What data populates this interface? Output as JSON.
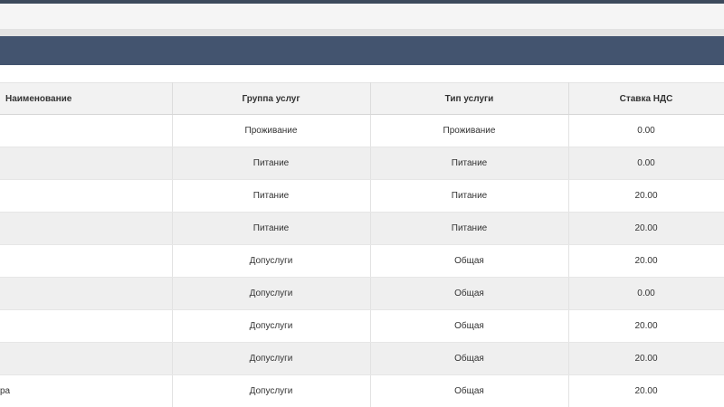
{
  "table": {
    "headers": [
      "Наименование",
      "Группа услуг",
      "Тип услуги",
      "Ставка НДС"
    ],
    "rows": [
      {
        "name": "",
        "group": "Проживание",
        "type": "Проживание",
        "vat": "0.00"
      },
      {
        "name": "",
        "group": "Питание",
        "type": "Питание",
        "vat": "0.00"
      },
      {
        "name": "",
        "group": "Питание",
        "type": "Питание",
        "vat": "20.00"
      },
      {
        "name": "",
        "group": "Питание",
        "type": "Питание",
        "vat": "20.00"
      },
      {
        "name": "",
        "group": "Допуслуги",
        "type": "Общая",
        "vat": "20.00"
      },
      {
        "name": "",
        "group": "Допуслуги",
        "type": "Общая",
        "vat": "0.00"
      },
      {
        "name": "",
        "group": "Допуслуги",
        "type": "Общая",
        "vat": "20.00"
      },
      {
        "name": "",
        "group": "Допуслуги",
        "type": "Общая",
        "vat": "20.00"
      },
      {
        "name": "ра",
        "group": "Допуслуги",
        "type": "Общая",
        "vat": "20.00"
      }
    ]
  },
  "colors": {
    "header_bar": "#43546f",
    "row_alt": "#efefef",
    "table_header_bg": "#f2f2f2"
  }
}
